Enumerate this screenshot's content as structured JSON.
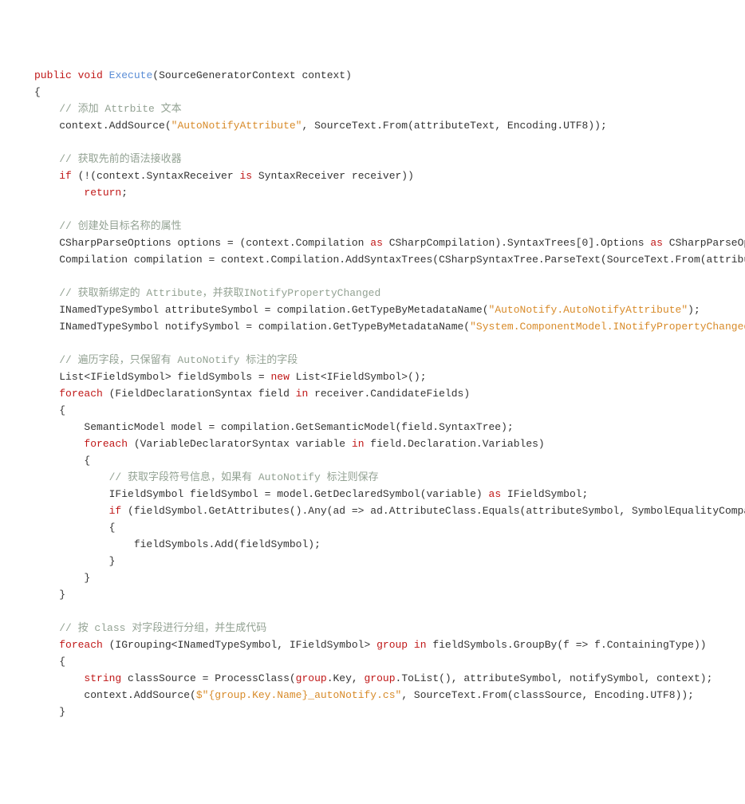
{
  "code": {
    "l1": {
      "kw1": "public",
      "kw2": "void",
      "fn": "Execute",
      "rest": "(SourceGeneratorContext context)"
    },
    "l2": "{",
    "l3_cmt": "// 添加 Attrbite 文本",
    "l4_a": "context.AddSource(",
    "l4_str": "\"AutoNotifyAttribute\"",
    "l4_b": ", SourceText.From(attributeText, Encoding.UTF8));",
    "l6_cmt": "// 获取先前的语法接收器",
    "l7_kw": "if",
    "l7_a": " (!(context.SyntaxReceiver ",
    "l7_is": "is",
    "l7_b": " SyntaxReceiver receiver))",
    "l8_kw": "return",
    "l8_b": ";",
    "l10_cmt": "// 创建处目标名称的属性",
    "l11_a": "CSharpParseOptions options = (context.Compilation ",
    "l11_as": "as",
    "l11_b": " CSharpCompilation).SyntaxTrees[0].Options ",
    "l11_as2": "as",
    "l11_c": " CSharpParseOp",
    "l12": "Compilation compilation = context.Compilation.AddSyntaxTrees(CSharpSyntaxTree.ParseText(SourceText.From(attribu",
    "l14_cmt": "// 获取新绑定的 Attribute，并获取INotifyPropertyChanged",
    "l15_a": "INamedTypeSymbol attributeSymbol = compilation.GetTypeByMetadataName(",
    "l15_str": "\"AutoNotify.AutoNotifyAttribute\"",
    "l15_b": ");",
    "l16_a": "INamedTypeSymbol notifySymbol = compilation.GetTypeByMetadataName(",
    "l16_str": "\"System.ComponentModel.INotifyPropertyChanged",
    "l18_cmt": "// 遍历字段，只保留有 AutoNotify 标注的字段",
    "l19_a": "List<IFieldSymbol> fieldSymbols = ",
    "l19_new": "new",
    "l19_b": " List<IFieldSymbol>();",
    "l20_kw": "foreach",
    "l20_a": " (FieldDeclarationSyntax field ",
    "l20_in": "in",
    "l20_b": " receiver.CandidateFields)",
    "l21": "{",
    "l22_a": "SemanticModel model = compilation.GetSemanticModel(field.SyntaxTree);",
    "l23_kw": "foreach",
    "l23_a": " (VariableDeclaratorSyntax variable ",
    "l23_in": "in",
    "l23_b": " field.Declaration.Variables)",
    "l24": "{",
    "l25_cmt": "// 获取字段符号信息，如果有 AutoNotify 标注则保存",
    "l26_a": "IFieldSymbol fieldSymbol = model.GetDeclaredSymbol(variable) ",
    "l26_as": "as",
    "l26_b": " IFieldSymbol;",
    "l27_kw": "if",
    "l27_a": " (fieldSymbol.GetAttributes().Any(ad => ad.AttributeClass.Equals(attributeSymbol, SymbolEqualityCompa",
    "l28": "{",
    "l29": "fieldSymbols.Add(fieldSymbol);",
    "l30": "}",
    "l31": "}",
    "l32": "}",
    "l34_cmt": "// 按 class 对字段进行分组，并生成代码",
    "l35_kw": "foreach",
    "l35_a": " (IGrouping<INamedTypeSymbol, IFieldSymbol> ",
    "l35_grp": "group",
    "l35_in": " in",
    "l35_b": " fieldSymbols.GroupBy(f => f.ContainingType))",
    "l36": "{",
    "l37_kw": "string",
    "l37_a": " classSource = ProcessClass(",
    "l37_grp1": "group",
    "l37_b": ".Key, ",
    "l37_grp2": "group",
    "l37_c": ".ToList(), attributeSymbol, notifySymbol, context);",
    "l38_a": "context.AddSource(",
    "l38_str": "$\"{group.Key.Name}_autoNotify.cs\"",
    "l38_b": ", SourceText.From(classSource, Encoding.UTF8));",
    "l39": "}"
  },
  "indent": {
    "i1": "    ",
    "i2": "        ",
    "i3": "            ",
    "i4": "                ",
    "i5": "                    "
  }
}
